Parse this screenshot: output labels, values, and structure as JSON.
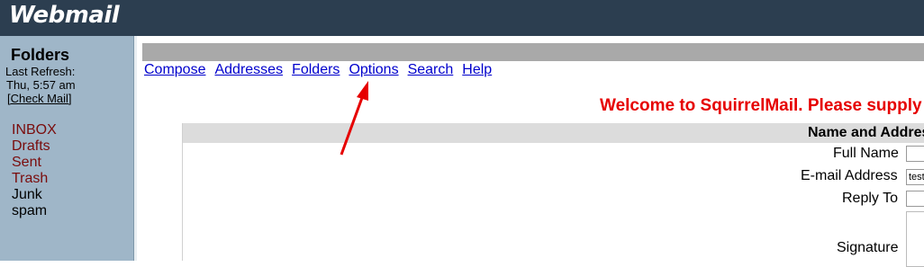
{
  "app": {
    "logo": "Webmail"
  },
  "sidebar": {
    "title": "Folders",
    "last_refresh_label": "Last Refresh:",
    "last_refresh_time": "Thu, 5:57 am",
    "check_mail": "[Check Mail]",
    "folders": [
      {
        "label": "INBOX"
      },
      {
        "label": "Drafts"
      },
      {
        "label": "Sent"
      },
      {
        "label": "Trash"
      },
      {
        "label": "Junk"
      },
      {
        "label": "spam"
      }
    ]
  },
  "nav": {
    "items": [
      "Compose",
      "Addresses",
      "Folders",
      "Options",
      "Search",
      "Help"
    ]
  },
  "main": {
    "welcome": "Welcome to SquirrelMail. Please supply",
    "section_title": "Name and Addres",
    "fields": {
      "full_name_label": "Full Name",
      "full_name_value": "",
      "email_label": "E-mail Address",
      "email_value": "test",
      "reply_to_label": "Reply To",
      "reply_to_value": "",
      "signature_label": "Signature"
    }
  },
  "colors": {
    "topbar": "#2c3e50",
    "sidebar": "#9fb6c8",
    "special_folder": "#7a0c0c",
    "link": "#0000cc",
    "welcome": "#e60000",
    "annotation_arrow": "#e60000"
  }
}
